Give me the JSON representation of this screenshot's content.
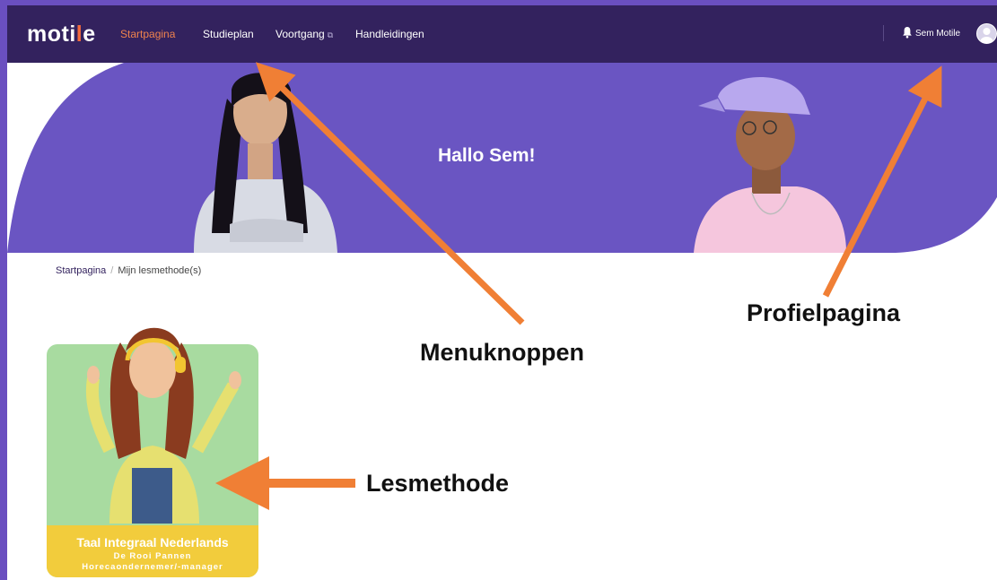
{
  "nav": {
    "logo_prefix": "moti",
    "logo_accent": "l",
    "logo_suffix": "e",
    "items": [
      {
        "label": "Startpagina",
        "active": true
      },
      {
        "label": "Studieplan"
      },
      {
        "label": "Voortgang",
        "external_icon": "external-link-icon"
      },
      {
        "label": "Handleidingen"
      }
    ],
    "notification_icon": "bell-icon",
    "user_name": "Sem Motile"
  },
  "hero": {
    "greeting": "Hallo Sem!"
  },
  "breadcrumb": {
    "home": "Startpagina",
    "separator": "/",
    "current": "Mijn lesmethode(s)"
  },
  "method_card": {
    "title": "Taal Integraal Nederlands",
    "subtitle_1": "De Rooi Pannen",
    "subtitle_2": "Horecaondernemer/-manager"
  },
  "annotations": {
    "menu": "Menuknoppen",
    "profile": "Profielpagina",
    "method": "Lesmethode"
  },
  "colors": {
    "nav_bg": "#33225e",
    "hero_bg": "#6a55c2",
    "accent_orange": "#f0834d",
    "arrow": "#f07f35",
    "card_green": "#a8dba0",
    "card_yellow": "#f2cc3c"
  }
}
